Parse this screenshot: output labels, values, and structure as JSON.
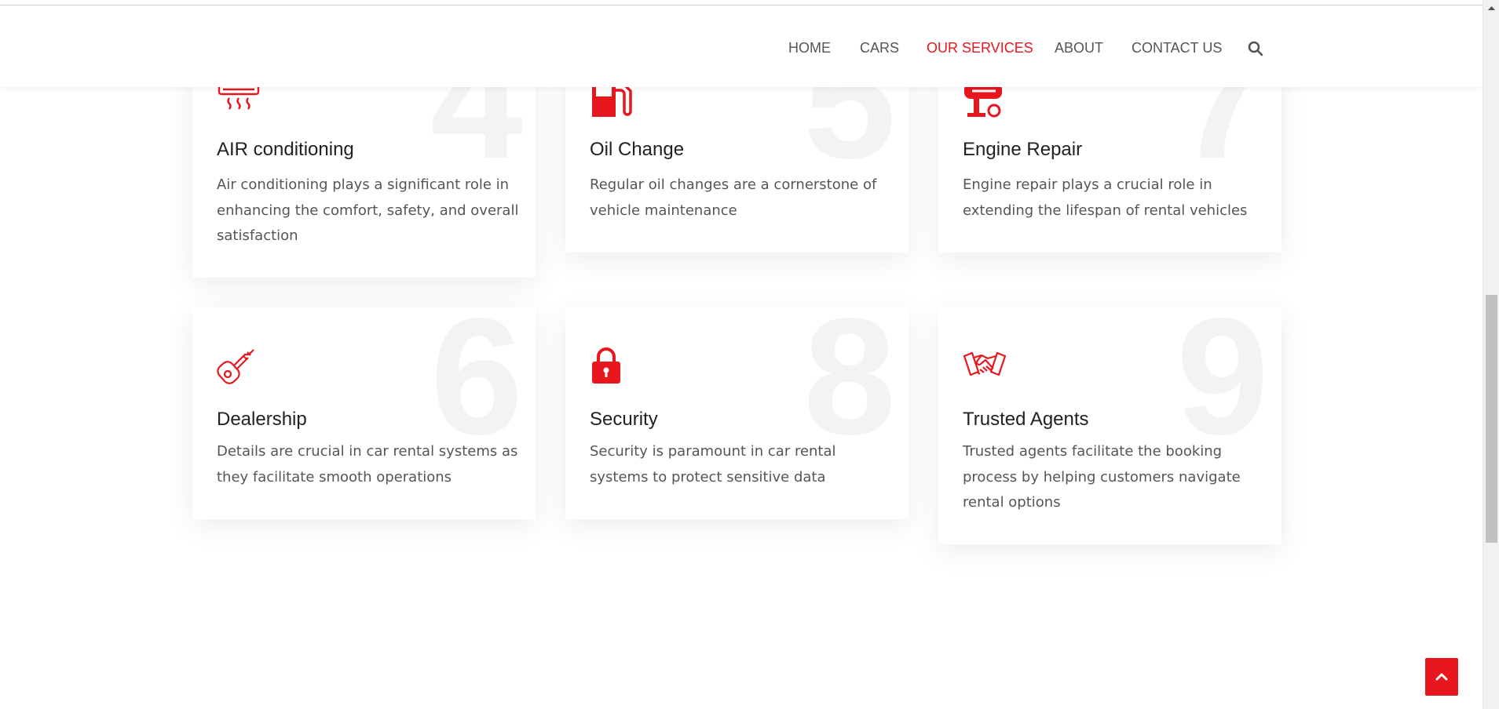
{
  "nav": {
    "items": [
      {
        "label": "HOME",
        "active": false
      },
      {
        "label": "CARS",
        "active": false
      },
      {
        "label": "OUR SERVICES",
        "active": true
      },
      {
        "label": "ABOUT",
        "active": false
      },
      {
        "label": "CONTACT US",
        "active": false
      }
    ],
    "search_icon": "search-icon"
  },
  "services": [
    {
      "number": "4",
      "icon": "air-conditioner-icon",
      "title": "AIR conditioning",
      "description": "Air conditioning plays a significant role in enhancing the comfort, safety, and overall satisfaction"
    },
    {
      "number": "5",
      "icon": "fuel-pump-icon",
      "title": "Oil Change",
      "description": "Regular oil changes are a cornerstone of vehicle maintenance"
    },
    {
      "number": "7",
      "icon": "engine-icon",
      "title": "Engine Repair",
      "description": "Engine repair plays a crucial role in extending the lifespan of rental vehicles"
    },
    {
      "number": "6",
      "icon": "car-key-icon",
      "title": "Dealership",
      "description": "Details are crucial in car rental systems as they facilitate smooth operations"
    },
    {
      "number": "8",
      "icon": "lock-icon",
      "title": "Security",
      "description": "Security is paramount in car rental systems to protect sensitive data"
    },
    {
      "number": "9",
      "icon": "handshake-icon",
      "title": "Trusted Agents",
      "description": "Trusted agents facilitate the booking process by helping customers navigate rental options"
    }
  ],
  "colors": {
    "accent": "#e8161d",
    "text": "#212121",
    "muted": "#555555",
    "watermark": "#f3f3f3"
  },
  "back_to_top_icon": "chevron-up-icon"
}
